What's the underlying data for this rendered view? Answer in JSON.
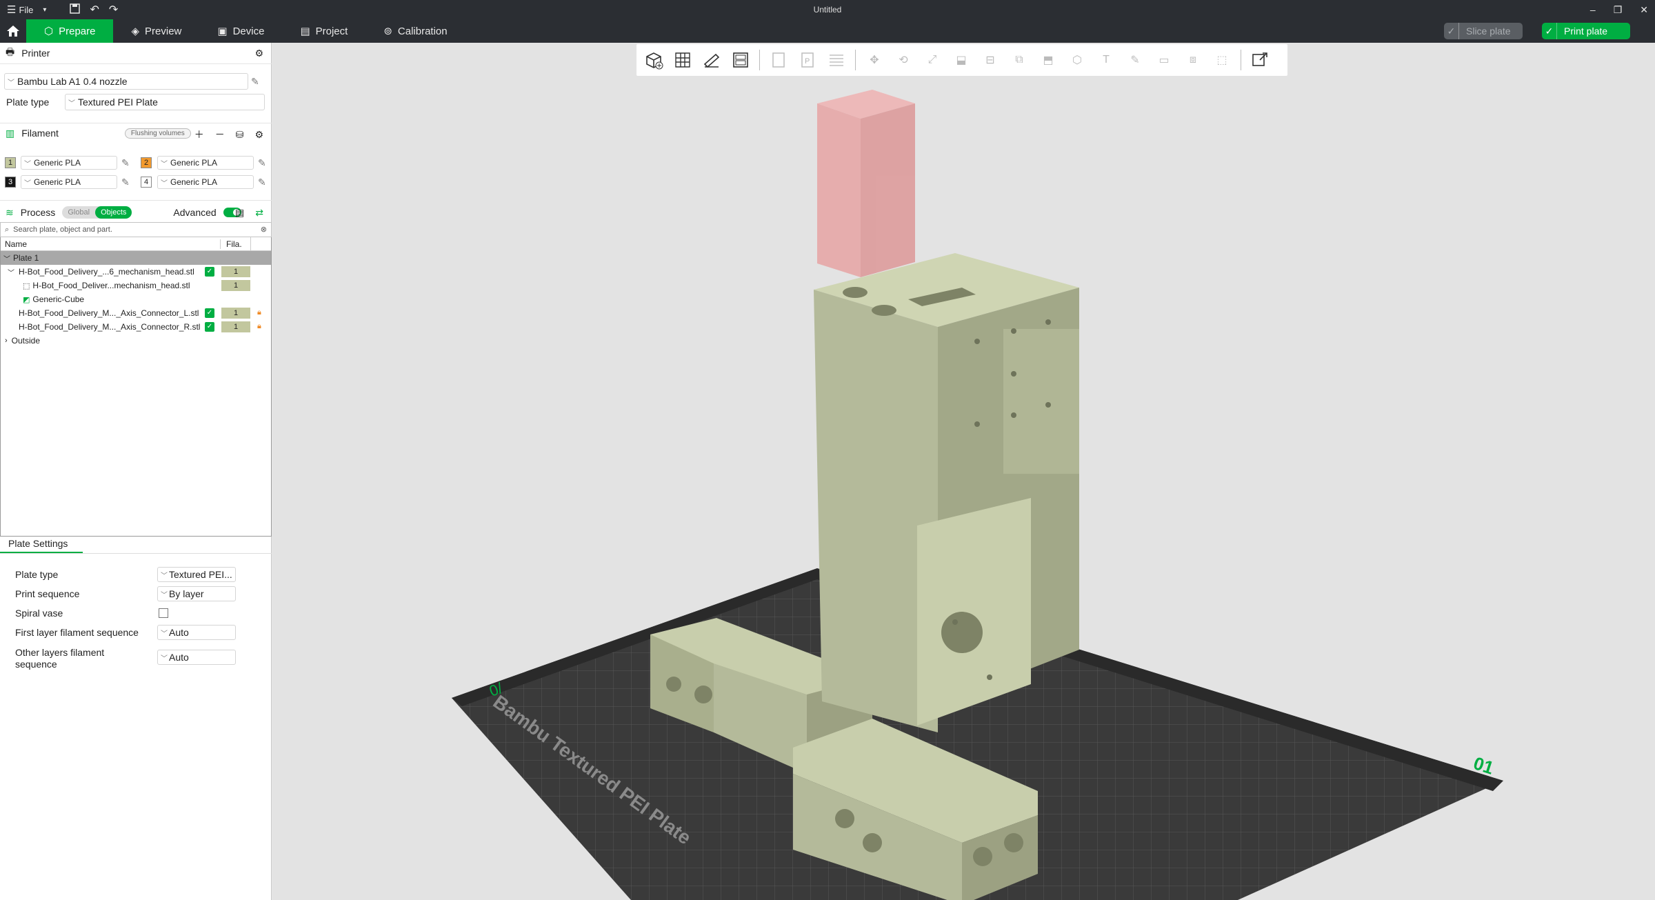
{
  "titlebar": {
    "file_label": "File",
    "title": "Untitled"
  },
  "menubar": {
    "tabs": [
      {
        "label": "Prepare",
        "icon": "prepare-cube-icon"
      },
      {
        "label": "Preview",
        "icon": "preview-layers-icon"
      },
      {
        "label": "Device",
        "icon": "device-icon"
      },
      {
        "label": "Project",
        "icon": "project-icon"
      },
      {
        "label": "Calibration",
        "icon": "calibration-icon"
      }
    ],
    "slice_label": "Slice plate",
    "print_label": "Print plate"
  },
  "printer": {
    "header": "Printer",
    "selected": "Bambu Lab A1 0.4 nozzle",
    "plate_type_label": "Plate type",
    "plate_type_value": "Textured PEI Plate"
  },
  "filament": {
    "header": "Filament",
    "flushing_label": "Flushing volumes",
    "slots": [
      {
        "num": "1",
        "name": "Generic PLA",
        "color": "#c2c79e"
      },
      {
        "num": "2",
        "name": "Generic PLA",
        "color": "#f29a2e"
      },
      {
        "num": "3",
        "name": "Generic PLA",
        "color": "#161616"
      },
      {
        "num": "4",
        "name": "Generic PLA",
        "color": "#ffffff"
      }
    ]
  },
  "process": {
    "header": "Process",
    "global_label": "Global",
    "objects_label": "Objects",
    "advanced_label": "Advanced"
  },
  "objects": {
    "search_placeholder": "Search plate, object and part.",
    "col_name": "Name",
    "col_fila": "Fila.",
    "plate": "Plate 1",
    "rows": [
      {
        "name": "H-Bot_Food_Delivery_...6_mechanism_head.stl",
        "fila": "1"
      },
      {
        "name": "H-Bot_Food_Deliver...mechanism_head.stl",
        "fila": "1"
      },
      {
        "name": "Generic-Cube"
      },
      {
        "name": "H-Bot_Food_Delivery_M..._Axis_Connector_L.stl",
        "fila": "1"
      },
      {
        "name": "H-Bot_Food_Delivery_M..._Axis_Connector_R.stl",
        "fila": "1"
      }
    ],
    "outside": "Outside"
  },
  "plate_settings": {
    "title": "Plate Settings",
    "plate_type_label": "Plate type",
    "plate_type_value": "Textured PEI...",
    "print_sequence_label": "Print sequence",
    "print_sequence_value": "By layer",
    "spiral_vase_label": "Spiral vase",
    "first_layer_label": "First layer filament sequence",
    "first_layer_value": "Auto",
    "other_layers_label_1": "Other layers filament",
    "other_layers_label_2": "sequence",
    "other_layers_value": "Auto"
  },
  "viewport": {
    "bed_label": "Bambu Textured PEI Plate",
    "plate_number": "01",
    "bed_color": "#3a3a3a",
    "model_color": "#b4ba9a",
    "cube_color": "#e89999"
  },
  "theme": {
    "accent": "#00ae42",
    "bar_bg": "#2b2e33"
  }
}
